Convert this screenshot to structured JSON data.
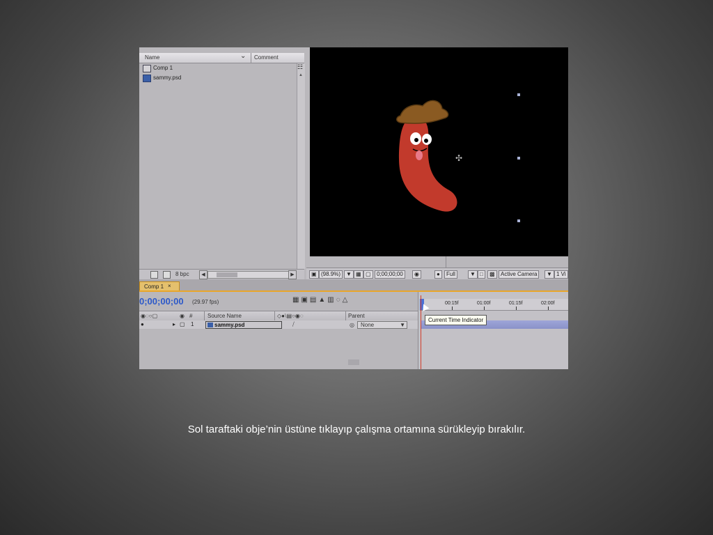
{
  "project_panel": {
    "col_name": "Name",
    "col_comment": "Comment",
    "items": [
      {
        "label": "Comp 1",
        "type": "comp"
      },
      {
        "label": "sammy.psd",
        "type": "psd"
      }
    ],
    "bpc": "8 bpc"
  },
  "viewer": {
    "zoom": "(98.9%)",
    "timecode": "0;00;00;00",
    "resolution": "Full",
    "camera": "Active Camera",
    "views": "1 Vi"
  },
  "timeline": {
    "tab_label": "Comp 1",
    "tab_close": "×",
    "current_time": "0;00;00;00",
    "fps": "(29.97 fps)",
    "columns": {
      "source_name": "Source Name",
      "hash": "#",
      "parent": "Parent"
    },
    "layer": {
      "number": "1",
      "name": "sammy.psd",
      "parent": "None"
    },
    "ruler_labels": [
      "00:15f",
      "01:00f",
      "01:15f",
      "02:00f"
    ],
    "tooltip": "Current Time Indicator"
  },
  "caption": "Sol taraftaki obje’nin üstüne tıklayıp çalışma ortamına sürükleyip bırakılır.",
  "colors": {
    "timecode_blue": "#2c59c9",
    "tab_orange": "#e9a62a",
    "playhead_red": "#d23b2b",
    "sausage_red": "#c23a2c",
    "hat_brown": "#8a5a22"
  }
}
